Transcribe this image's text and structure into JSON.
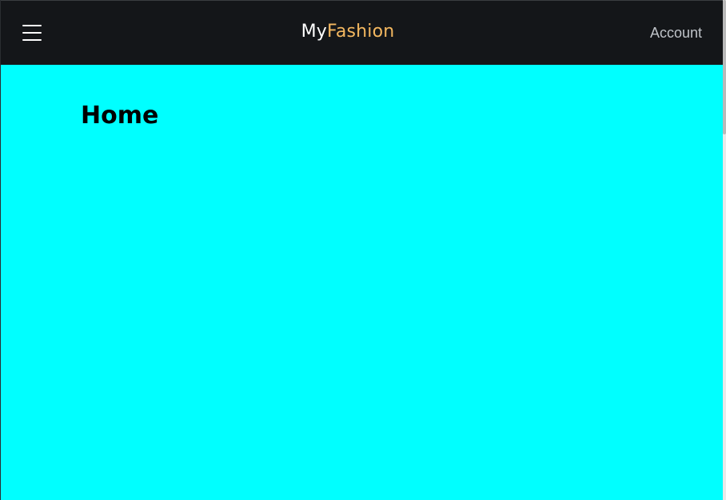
{
  "header": {
    "menu_icon": "hamburger-menu-icon",
    "brand": {
      "part1": "My",
      "part2": "Fashion"
    },
    "account_label": "Account"
  },
  "main": {
    "title": "Home"
  },
  "colors": {
    "header_background": "#141619",
    "page_background": "#00ffff",
    "brand_accent": "#f4b860",
    "account_text": "#bfc3c8"
  }
}
